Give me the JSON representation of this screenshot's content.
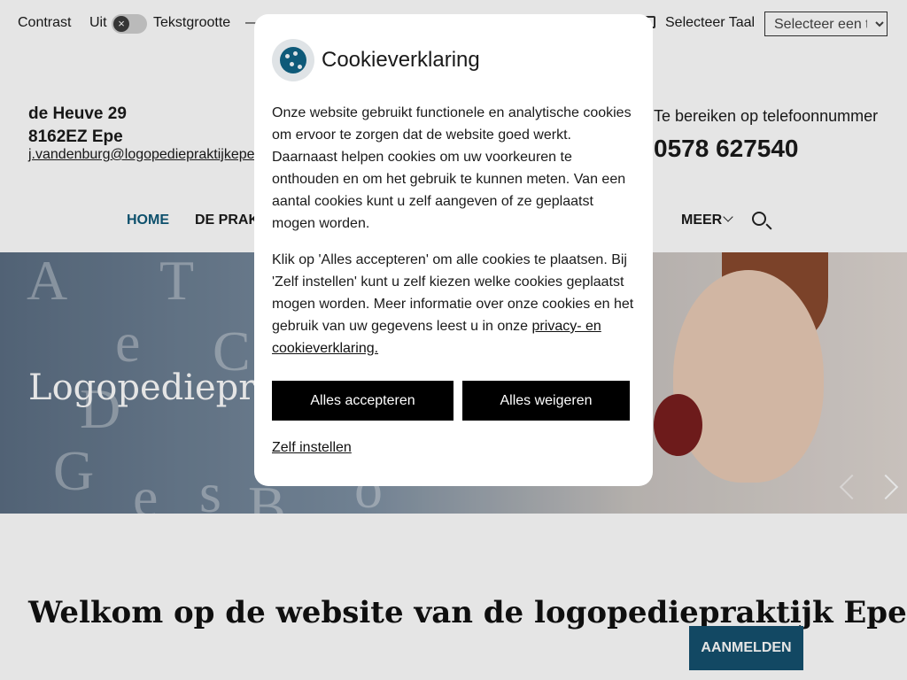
{
  "topbar": {
    "contrast_label": "Contrast",
    "contrast_state": "Uit",
    "toggle_icon": "×",
    "text_size_label": "Tekstgrootte",
    "text_size_dash": "—",
    "select_language_label": "Selecteer Taal",
    "language_select_value": "Selecteer een taal"
  },
  "header": {
    "address_line1": "de Heuve 29",
    "address_line2": "8162EZ Epe",
    "email": "j.vandenburg@logopediepraktijkepe.",
    "phone_label": "Te bereiken op telefoonnummer",
    "phone": "0578 627540"
  },
  "nav": {
    "home": "HOME",
    "praktijk": "DE PRAKT",
    "more": "MEER"
  },
  "hero": {
    "title": "Logopediepraktijk",
    "letters": [
      "A",
      "T",
      "e",
      "C",
      "D",
      "G",
      "e",
      "s",
      "B",
      "o"
    ]
  },
  "main": {
    "welcome_title": "Welkom op de website van de logopediepraktijk Epe",
    "signup_button": "AANMELDEN"
  },
  "cookie_modal": {
    "title": "Cookieverklaring",
    "paragraph1": "Onze website gebruikt functionele en analytische cookies om ervoor te zorgen dat de website goed werkt. Daarnaast helpen cookies om uw voorkeuren te onthouden en om het gebruik te kunnen meten. Van een aantal cookies kunt u zelf aangeven of ze geplaatst mogen worden.",
    "paragraph2_text": "Klik op 'Alles accepteren' om alle cookies te plaatsen. Bij 'Zelf instellen' kunt u zelf kiezen welke cookies geplaatst mogen worden. Meer informatie over onze cookies en het gebruik van uw gegevens leest u in onze ",
    "privacy_link": "privacy- en cookieverklaring.",
    "accept_all": "Alles accepteren",
    "reject_all": "Alles weigeren",
    "customize": "Zelf instellen"
  },
  "colors": {
    "brand": "#0f5a79",
    "cta": "#15516f",
    "button_dark": "#000000"
  },
  "icons": {
    "cookie": "cookie-icon",
    "search": "search-icon",
    "chevron": "chevron-down-icon",
    "close": "close-icon",
    "prev": "chevron-left-icon",
    "next": "chevron-right-icon",
    "language": "language-icon"
  }
}
